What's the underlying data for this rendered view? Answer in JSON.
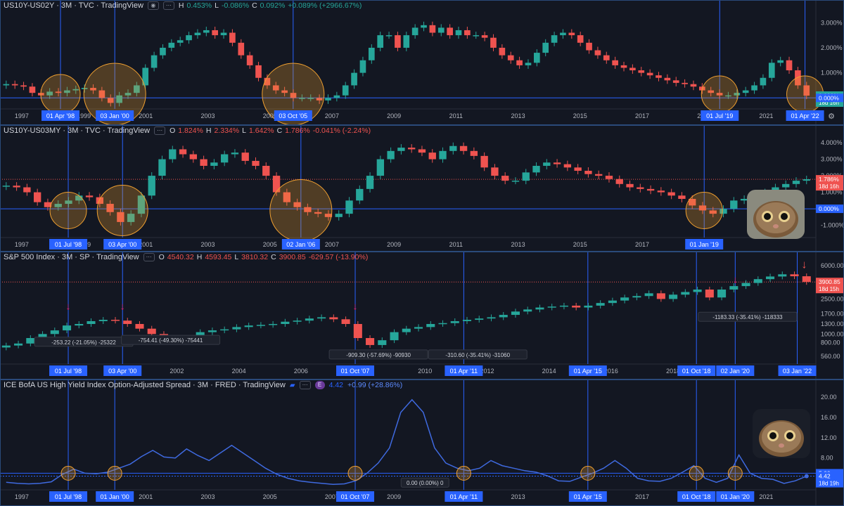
{
  "colors": {
    "bg": "#131722",
    "up": "#26a69a",
    "down": "#ef5350",
    "hline": "#2962ff",
    "vline": "#2962ff",
    "circle": "#f0a030",
    "xlabel_bg": "#2962ff",
    "axis_text": "#b2b5be",
    "blue_line": "#3f6ae0"
  },
  "panes": [
    {
      "id": "us10y-us02y",
      "header": {
        "symbol": "US10Y-US02Y · 3M · TVC · TradingView",
        "ohlc": [
          [
            "O",
            ""
          ],
          [
            "H",
            "0.453%"
          ],
          [
            "L",
            "-0.086%"
          ],
          [
            "C",
            "0.092%"
          ],
          [
            "",
            "+0.089% (+2966.67%)"
          ]
        ],
        "ohlc_color": "up"
      },
      "y_ticks": [
        "3.000%",
        "2.000%",
        "1.000%",
        "0.000%"
      ],
      "price_tags": [
        {
          "text": "0.092%",
          "text2": "18d 16h",
          "color": "#26a69a"
        },
        {
          "text": "0.000%",
          "text2": "",
          "color": "#2962ff"
        }
      ],
      "x_ticks": [
        "1997",
        "1999",
        "2001",
        "2003",
        "2005",
        "2007",
        "2009",
        "2011",
        "2013",
        "2015",
        "2017",
        "2019",
        "2021"
      ],
      "x_labels": [
        "01 Apr '98",
        "03 Jan '00",
        "03 Oct '05",
        "01 Jul '19",
        "01 Apr '22"
      ]
    },
    {
      "id": "us10y-us03my",
      "header": {
        "symbol": "US10Y-US03MY · 3M · TVC · TradingView",
        "ohlc": [
          [
            "O",
            "1.824%"
          ],
          [
            "H",
            "2.334%"
          ],
          [
            "L",
            "1.642%"
          ],
          [
            "C",
            "1.786%"
          ],
          [
            "",
            "-0.041% (-2.24%)"
          ]
        ],
        "ohlc_color": "down"
      },
      "y_ticks": [
        "4.000%",
        "3.000%",
        "2.000%",
        "1.000%",
        "0.000%",
        "-1.000%"
      ],
      "price_tags": [
        {
          "text": "1.786%",
          "text2": "18d 16h",
          "color": "#ef5350"
        },
        {
          "text": "0.000%",
          "text2": "",
          "color": "#2962ff"
        }
      ],
      "x_ticks": [
        "1997",
        "1999",
        "2001",
        "2003",
        "2005",
        "2007",
        "2009",
        "2011",
        "2013",
        "2015",
        "2017"
      ],
      "x_labels": [
        "01 Jul '98",
        "03 Apr '00",
        "02 Jan '06",
        "01 Jan '19"
      ]
    },
    {
      "id": "spx",
      "header": {
        "symbol": "S&P 500 Index · 3M · SP · TradingView",
        "ohlc": [
          [
            "O",
            "4540.32"
          ],
          [
            "H",
            "4593.45"
          ],
          [
            "L",
            "3810.32"
          ],
          [
            "C",
            "3900.85"
          ],
          [
            "",
            "-629.57 (-13.90%)"
          ]
        ],
        "ohlc_color": "down"
      },
      "y_ticks": [
        "6000.00",
        "3900.85",
        "2500.00",
        "1700.00",
        "1300.00",
        "1000.00",
        "800.00",
        "560.00"
      ],
      "price_tags": [
        {
          "text": "3900.85",
          "text2": "18d 15h",
          "color": "#ef5350"
        }
      ],
      "x_ticks": [
        "19",
        "2002",
        "2004",
        "2006",
        "2010",
        "2012",
        "2014",
        "2016",
        "2018"
      ],
      "x_labels": [
        "01 Jul '98",
        "03 Apr '00",
        "01 Oct '07",
        "01 Apr '11",
        "01 Apr '15",
        "01 Oct '18",
        "02 Jan '20",
        "03 Jan '22"
      ],
      "measures": [
        "-253.22 (-21.05%) -25322",
        "-754.41 (-49.30%) -75441",
        "-909.30 (-57.69%) -90930",
        "-310.60 (-35.41%) -31060",
        "-1183.33 (-35.41%) -118333"
      ]
    },
    {
      "id": "hy-spread",
      "header": {
        "symbol": "ICE BofA US High Yield Index Option-Adjusted Spread · 3M · FRED · TradingView",
        "badge": "E",
        "value": "4.42",
        "change": "+0.99 (+28.86%)"
      },
      "y_ticks": [
        "20.00",
        "16.00",
        "12.00",
        "8.00",
        "5.00",
        "4.42"
      ],
      "price_tags": [
        {
          "text": "5.00",
          "text2": "",
          "color": "#2962ff"
        },
        {
          "text": "4.42",
          "text2": "18d 19h",
          "color": "#2962ff"
        }
      ],
      "x_ticks": [
        "1997",
        "2001",
        "2003",
        "2005",
        "2007",
        "2009",
        "2013",
        "2017",
        "2021"
      ],
      "x_labels": [
        "01 Jul '98",
        "01 Jan '00",
        "01 Oct '07",
        "01 Apr '11",
        "01 Apr '15",
        "01 Oct '18",
        "01 Jan '20"
      ],
      "measure": "0.00 (0.00%) 0"
    }
  ],
  "chart_data": [
    {
      "type": "candlestick",
      "title": "US10Y-US02Y",
      "ylabel": "%",
      "ylim": [
        -0.3,
        3.4
      ],
      "series": [
        {
          "name": "US10Y-US02Y",
          "values": [
            0.55,
            0.5,
            0.45,
            0.2,
            0.1,
            0.25,
            0.2,
            0.3,
            0.35,
            0.4,
            0.3,
            0.0,
            -0.2,
            0.1,
            0.2,
            0.5,
            1.2,
            1.7,
            2.0,
            2.2,
            2.3,
            2.5,
            2.6,
            2.7,
            2.5,
            2.6,
            2.2,
            1.7,
            1.3,
            0.8,
            0.5,
            0.3,
            0.2,
            0.0,
            0.0,
            0.0,
            -0.1,
            0.0,
            0.1,
            0.5,
            1.0,
            1.5,
            2.0,
            2.5,
            2.5,
            2.0,
            2.5,
            2.8,
            2.9,
            2.6,
            2.8,
            2.5,
            2.7,
            2.5,
            2.5,
            2.4,
            2.0,
            1.7,
            1.5,
            1.3,
            1.4,
            1.8,
            2.2,
            2.5,
            2.6,
            2.5,
            2.2,
            1.9,
            1.7,
            1.5,
            1.3,
            1.2,
            1.1,
            1.0,
            0.9,
            0.8,
            0.7,
            0.6,
            0.55,
            0.45,
            0.3,
            0.2,
            0.1,
            0.1,
            0.2,
            0.3,
            0.5,
            0.8,
            1.4,
            1.5,
            1.1,
            0.5,
            0.09
          ]
        }
      ]
    },
    {
      "type": "candlestick",
      "title": "US10Y-US03MY",
      "ylabel": "%",
      "ylim": [
        -1.4,
        4.3
      ],
      "series": [
        {
          "name": "US10Y-US03MY",
          "values": [
            1.4,
            1.3,
            1.0,
            0.4,
            0.1,
            0.3,
            0.5,
            0.8,
            0.7,
            0.3,
            -0.2,
            -0.8,
            -0.3,
            0.8,
            2.0,
            3.0,
            3.6,
            3.3,
            3.0,
            2.6,
            2.8,
            3.3,
            3.4,
            2.9,
            2.6,
            2.0,
            1.0,
            0.4,
            0.1,
            -0.2,
            -0.3,
            -0.5,
            -0.3,
            0.5,
            1.2,
            2.0,
            3.0,
            3.5,
            3.7,
            3.6,
            3.4,
            3.0,
            3.5,
            3.8,
            3.5,
            3.2,
            2.5,
            2.0,
            1.7,
            1.7,
            2.2,
            2.6,
            2.8,
            2.7,
            2.5,
            2.3,
            2.1,
            2.0,
            1.8,
            1.5,
            1.3,
            1.2,
            1.1,
            1.0,
            0.8,
            0.6,
            0.2,
            -0.1,
            -0.3,
            0.0,
            0.5,
            0.6,
            0.8,
            1.0,
            1.3,
            1.5,
            1.7,
            1.79
          ]
        }
      ]
    },
    {
      "type": "candlestick",
      "title": "S&P 500 Index",
      "ylabel": "",
      "ylim": [
        500,
        6200
      ],
      "series": [
        {
          "name": "S&P 500 Index",
          "values": [
            740,
            780,
            900,
            1000,
            1100,
            1250,
            1300,
            1400,
            1450,
            1420,
            1300,
            1150,
            1000,
            850,
            820,
            900,
            1050,
            1100,
            1130,
            1200,
            1250,
            1270,
            1300,
            1380,
            1420,
            1500,
            1550,
            1470,
            1300,
            900,
            750,
            850,
            1050,
            1150,
            1200,
            1300,
            1330,
            1400,
            1450,
            1500,
            1550,
            1650,
            1800,
            1900,
            2000,
            2050,
            2100,
            2000,
            2100,
            2250,
            2400,
            2600,
            2700,
            2900,
            2500,
            2800,
            3000,
            3200,
            2600,
            3200,
            3500,
            3800,
            4200,
            4500,
            4766,
            4530,
            3900.85
          ]
        }
      ]
    },
    {
      "type": "line",
      "title": "ICE BofA US High Yield Index Option-Adjusted Spread",
      "ylabel": "",
      "ylim": [
        2,
        21
      ],
      "series": [
        {
          "name": "ICE BofA US High Yield Index Option-Adjusted Spread",
          "values": [
            3.2,
            3.0,
            2.9,
            3.0,
            3.3,
            4.8,
            5.8,
            5.0,
            4.9,
            5.2,
            6.0,
            6.8,
            8.3,
            9.5,
            8.2,
            8.0,
            9.8,
            8.5,
            7.5,
            9.0,
            10.5,
            9.0,
            7.5,
            6.0,
            4.8,
            4.0,
            3.5,
            3.2,
            3.0,
            2.8,
            2.9,
            3.5,
            5.0,
            7.0,
            10.0,
            17.0,
            19.5,
            17.0,
            10.0,
            7.0,
            6.0,
            5.5,
            6.0,
            7.5,
            6.5,
            6.0,
            5.5,
            5.2,
            4.5,
            3.5,
            3.4,
            4.2,
            5.0,
            6.0,
            7.5,
            6.0,
            4.0,
            3.5,
            3.4,
            4.0,
            5.2,
            6.5,
            4.0,
            3.2,
            4.0,
            8.6,
            5.0,
            4.0,
            3.8,
            3.0,
            3.5,
            4.42
          ]
        }
      ]
    }
  ]
}
